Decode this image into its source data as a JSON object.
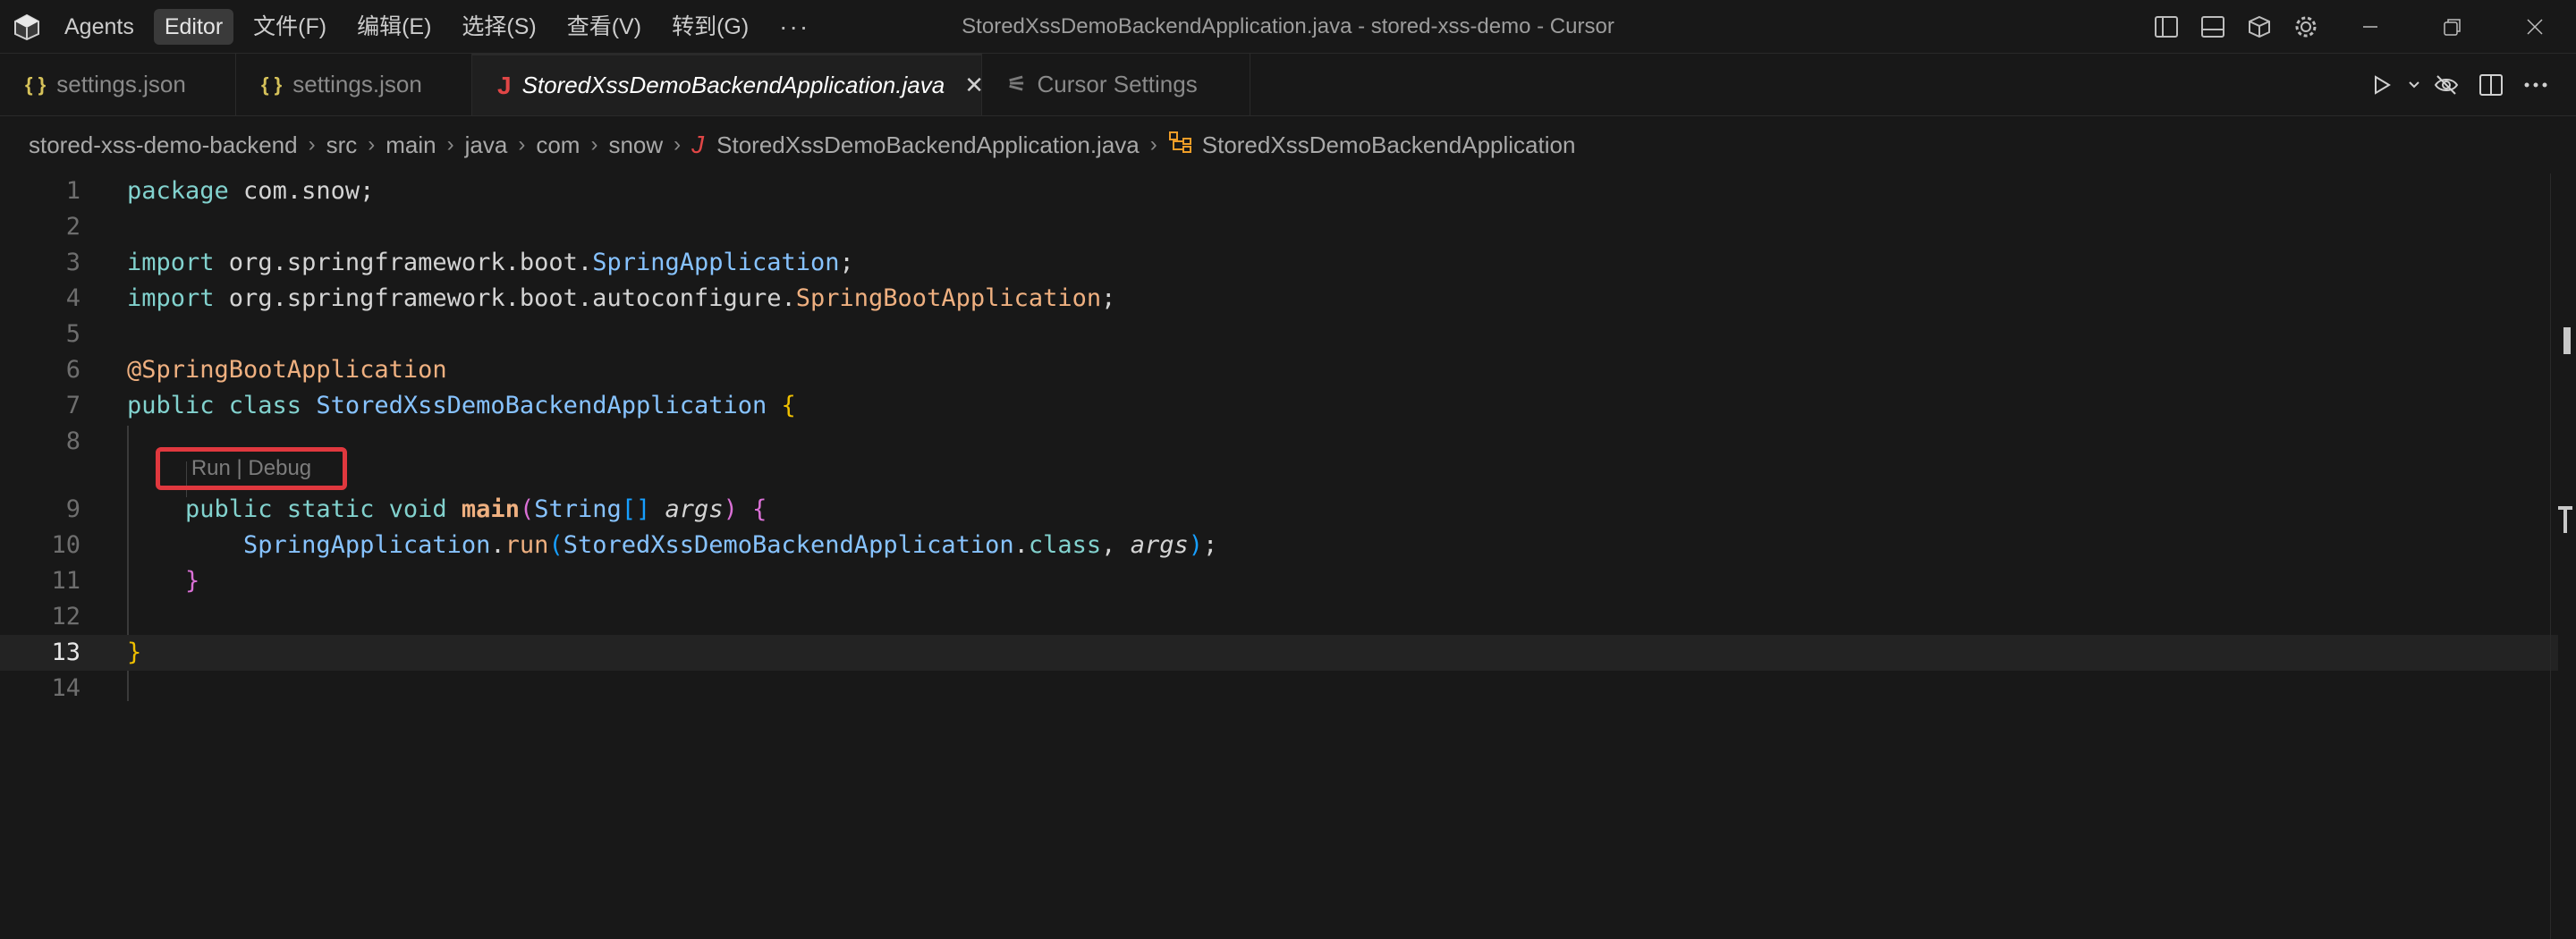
{
  "titlebar": {
    "menu": [
      "Agents",
      "Editor",
      "文件(F)",
      "编辑(E)",
      "选择(S)",
      "查看(V)",
      "转到(G)"
    ],
    "more": "···",
    "title": "StoredXssDemoBackendApplication.java - stored-xss-demo - Cursor"
  },
  "tabs": [
    {
      "label": "settings.json",
      "icon": "json-braces-icon",
      "active": false
    },
    {
      "label": "settings.json",
      "icon": "json-braces-icon",
      "active": false
    },
    {
      "label": "StoredXssDemoBackendApplication.java",
      "icon": "java-icon",
      "active": true
    },
    {
      "label": "Cursor Settings",
      "icon": "settings-sliders-icon",
      "active": false
    }
  ],
  "icons": {
    "json": "{ }",
    "java": "J",
    "close": "✕",
    "sliders": "⚟"
  },
  "breadcrumb": {
    "items": [
      "stored-xss-demo-backend",
      "src",
      "main",
      "java",
      "com",
      "snow"
    ],
    "file": "StoredXssDemoBackendApplication.java",
    "symbol": "StoredXssDemoBackendApplication",
    "sep": "›"
  },
  "editor": {
    "line_numbers": [
      "1",
      "2",
      "3",
      "4",
      "5",
      "6",
      "7",
      "8",
      "9",
      "10",
      "11",
      "12",
      "13",
      "14"
    ],
    "current_line": "13",
    "codelens": "Run | Debug",
    "lines": {
      "l1": {
        "kw": "package",
        "rest": " com.snow;"
      },
      "l3": {
        "kw": "import",
        "pkg": " org.springframework.boot.",
        "cls": "SpringApplication",
        "end": ";"
      },
      "l4": {
        "kw": "import",
        "pkg": " org.springframework.boot.autoconfigure.",
        "cls": "SpringBootApplication",
        "end": ";"
      },
      "l6": {
        "anno": "@SpringBootApplication"
      },
      "l7": {
        "kw": "public class",
        "sp": " ",
        "cls": "StoredXssDemoBackendApplication",
        "sp2": " ",
        "brace": "{"
      },
      "l9": {
        "indent": "    ",
        "kw": "public static",
        "sp": " ",
        "void": "void",
        "sp2": " ",
        "fn": "main",
        "p1": "(",
        "ty": "String",
        "arr": "[]",
        "sp3": " ",
        "arg": "args",
        "p2": ")",
        "sp4": " ",
        "brace": "{"
      },
      "l10": {
        "indent": "        ",
        "cls": "SpringApplication",
        "dot": ".",
        "fn": "run",
        "p1": "(",
        "cls2": "StoredXssDemoBackendApplication",
        "dot2": ".",
        "kw": "class",
        "comma": ", ",
        "arg": "args",
        "p2": ")",
        "end": ";"
      },
      "l11": {
        "indent": "    ",
        "brace": "}"
      },
      "l13": {
        "brace": "}"
      }
    }
  }
}
